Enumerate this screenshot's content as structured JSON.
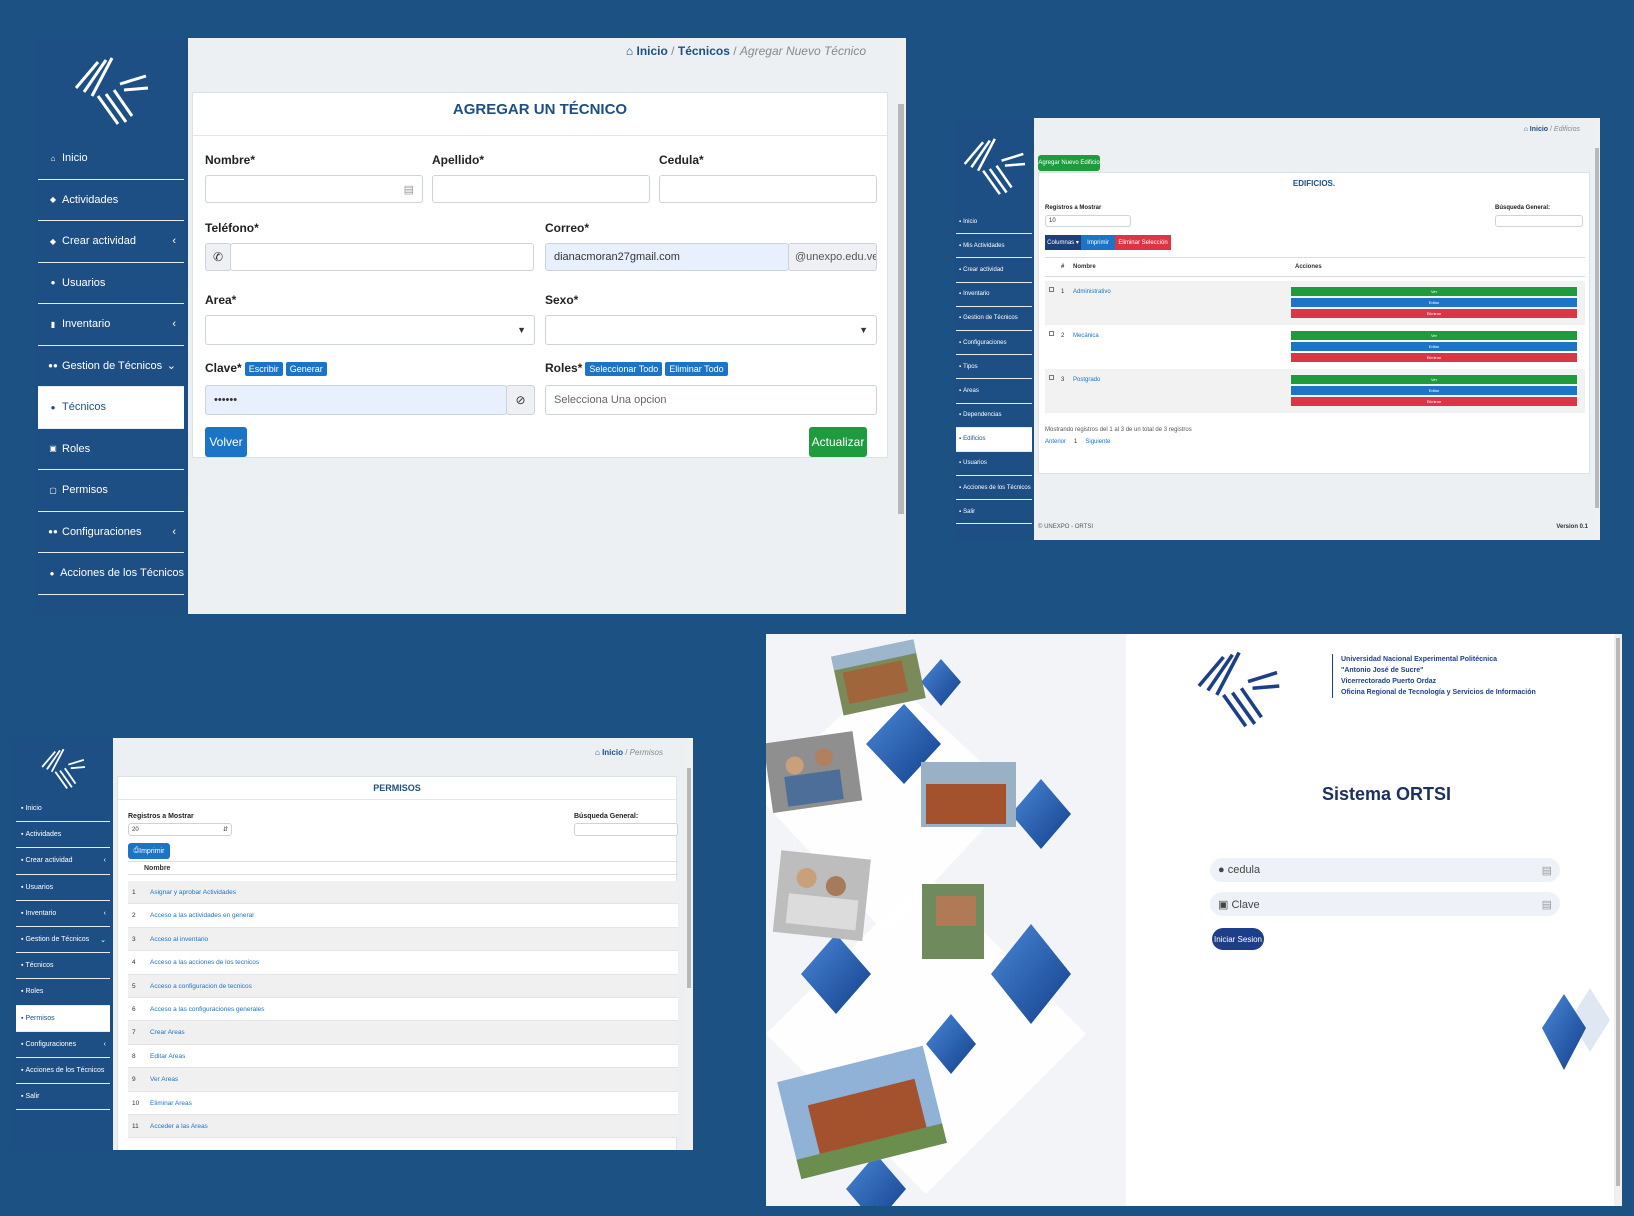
{
  "p1": {
    "nav": [
      {
        "icon": "home-icon",
        "glyph": "⌂",
        "label": "Inicio"
      },
      {
        "icon": "tag-icon",
        "glyph": "◆",
        "label": "Actividades"
      },
      {
        "icon": "tag-icon",
        "glyph": "◆",
        "label": "Crear actividad",
        "chev": "‹"
      },
      {
        "icon": "user-icon",
        "glyph": "●",
        "label": "Usuarios"
      },
      {
        "icon": "box-icon",
        "glyph": "▮",
        "label": "Inventario",
        "chev": "‹"
      },
      {
        "icon": "users-icon",
        "glyph": "●●",
        "label": "Gestion de Técnicos",
        "chev": "⌄"
      },
      {
        "icon": "user-icon",
        "glyph": "●",
        "label": "Técnicos",
        "active": true
      },
      {
        "icon": "lock-icon",
        "glyph": "▣",
        "label": "Roles"
      },
      {
        "icon": "unlock-icon",
        "glyph": "▢",
        "label": "Permisos"
      },
      {
        "icon": "users-icon",
        "glyph": "●●",
        "label": "Configuraciones",
        "chev": "‹"
      },
      {
        "icon": "user-icon",
        "glyph": "●",
        "label": "Acciones de los Técnicos"
      }
    ],
    "crumb": {
      "home": "Inicio",
      "sep": "/",
      "mid": "Técnicos",
      "current": "Agregar Nuevo Técnico"
    },
    "title": "AGREGAR UN TÉCNICO",
    "labels": {
      "nombre": "Nombre*",
      "apellido": "Apellido*",
      "cedula": "Cedula*",
      "telefono": "Teléfono*",
      "correo": "Correo*",
      "area": "Area*",
      "sexo": "Sexo*",
      "clave": "Clave*",
      "roles": "Roles*"
    },
    "correo_value": "dianacmoran27gmail.com",
    "correo_suffix": "@unexpo.edu.ve",
    "clave_value": "••••••",
    "roles_placeholder": "Selecciona Una opcion",
    "clave_buttons": [
      "Escribir",
      "Generar"
    ],
    "roles_buttons": [
      "Seleccionar Todo",
      "Eliminar Todo"
    ],
    "volver": "Volver",
    "actualizar": "Actualizar"
  },
  "p2": {
    "nav": [
      "Inicio",
      "Mis Actividades",
      "Crear actividad",
      "Inventario",
      "Gestion de Técnicos",
      "Configuraciones",
      "Tipos",
      "Areas",
      "Dependencias",
      "Edificios",
      "Usuarios",
      "Acciones de los Técnicos",
      "Salir"
    ],
    "crumb": {
      "home": "Inicio",
      "sep": "/",
      "current": "Edificios"
    },
    "add_button": "Agregar Nuevo Edificio",
    "title": "EDIFICIOS.",
    "registros_label": "Registros a Mostrar",
    "registros_value": "10",
    "busqueda_label": "Búsqueda General:",
    "toolbar": [
      "Columnas ▾",
      "Imprimir",
      "Eliminar Selección"
    ],
    "headers": [
      "#",
      "Nombre",
      "Acciones"
    ],
    "rows": [
      {
        "n": "1",
        "name": "Administrativo"
      },
      {
        "n": "2",
        "name": "Mecánica"
      },
      {
        "n": "3",
        "name": "Postgrado"
      }
    ],
    "actions": [
      "Ver",
      "Editar",
      "Eliminar"
    ],
    "info": "Mostrando registros del 1 al 3 de un total de 3 registros",
    "pager": [
      "Anterior",
      "1",
      "Siguiente"
    ],
    "footer_left": "© UNEXPO - ORTSI",
    "footer_right": "Version 0.1"
  },
  "p3": {
    "nav": [
      {
        "label": "Inicio"
      },
      {
        "label": "Actividades"
      },
      {
        "label": "Crear actividad",
        "chev": "‹"
      },
      {
        "label": "Usuarios"
      },
      {
        "label": "Inventario",
        "chev": "‹"
      },
      {
        "label": "Gestion de Técnicos",
        "chev": "⌄"
      },
      {
        "label": "Técnicos"
      },
      {
        "label": "Roles"
      },
      {
        "label": "Permisos",
        "active": true
      },
      {
        "label": "Configuraciones",
        "chev": "‹"
      },
      {
        "label": "Acciones de los Técnicos"
      },
      {
        "label": "Salir"
      }
    ],
    "crumb": {
      "home": "Inicio",
      "sep": "/",
      "current": "Permisos"
    },
    "title": "PERMISOS",
    "registros_label": "Registros a Mostrar",
    "registros_value": "20",
    "busqueda_label": "Búsqueda General:",
    "imprimir": "Imprimir",
    "header": "Nombre",
    "rows": [
      {
        "n": "1",
        "name": "Asignar y aprobar Actividades"
      },
      {
        "n": "2",
        "name": "Acceso a las actividades en general"
      },
      {
        "n": "3",
        "name": "Acceso al inventario"
      },
      {
        "n": "4",
        "name": "Acceso a las acciones de los tecnicos"
      },
      {
        "n": "5",
        "name": "Acceso a configuracion de tecnicos"
      },
      {
        "n": "6",
        "name": "Acceso a las configuraciones generales"
      },
      {
        "n": "7",
        "name": "Crear Areas"
      },
      {
        "n": "8",
        "name": "Editar Areas"
      },
      {
        "n": "9",
        "name": "Ver Areas"
      },
      {
        "n": "10",
        "name": "Eliminar Areas"
      },
      {
        "n": "11",
        "name": "Acceder a las Areas"
      }
    ]
  },
  "p4": {
    "institution": [
      "Universidad Nacional Experimental Politécnica",
      "\"Antonio José de Sucre\"",
      "Vicerrectorado Puerto Ordaz",
      "Oficina Regional de Tecnología y Servicios de Información"
    ],
    "title": "Sistema ORTSI",
    "cedula_placeholder": "cedula",
    "clave_placeholder": "Clave",
    "login": "Iniciar Sesion"
  },
  "colors": {
    "background": "#1c5283",
    "sidebar": "#1d4f85",
    "primary": "#1b74c5",
    "success": "#1e9b3d",
    "danger": "#dc3545",
    "title": "#1d4f85"
  }
}
